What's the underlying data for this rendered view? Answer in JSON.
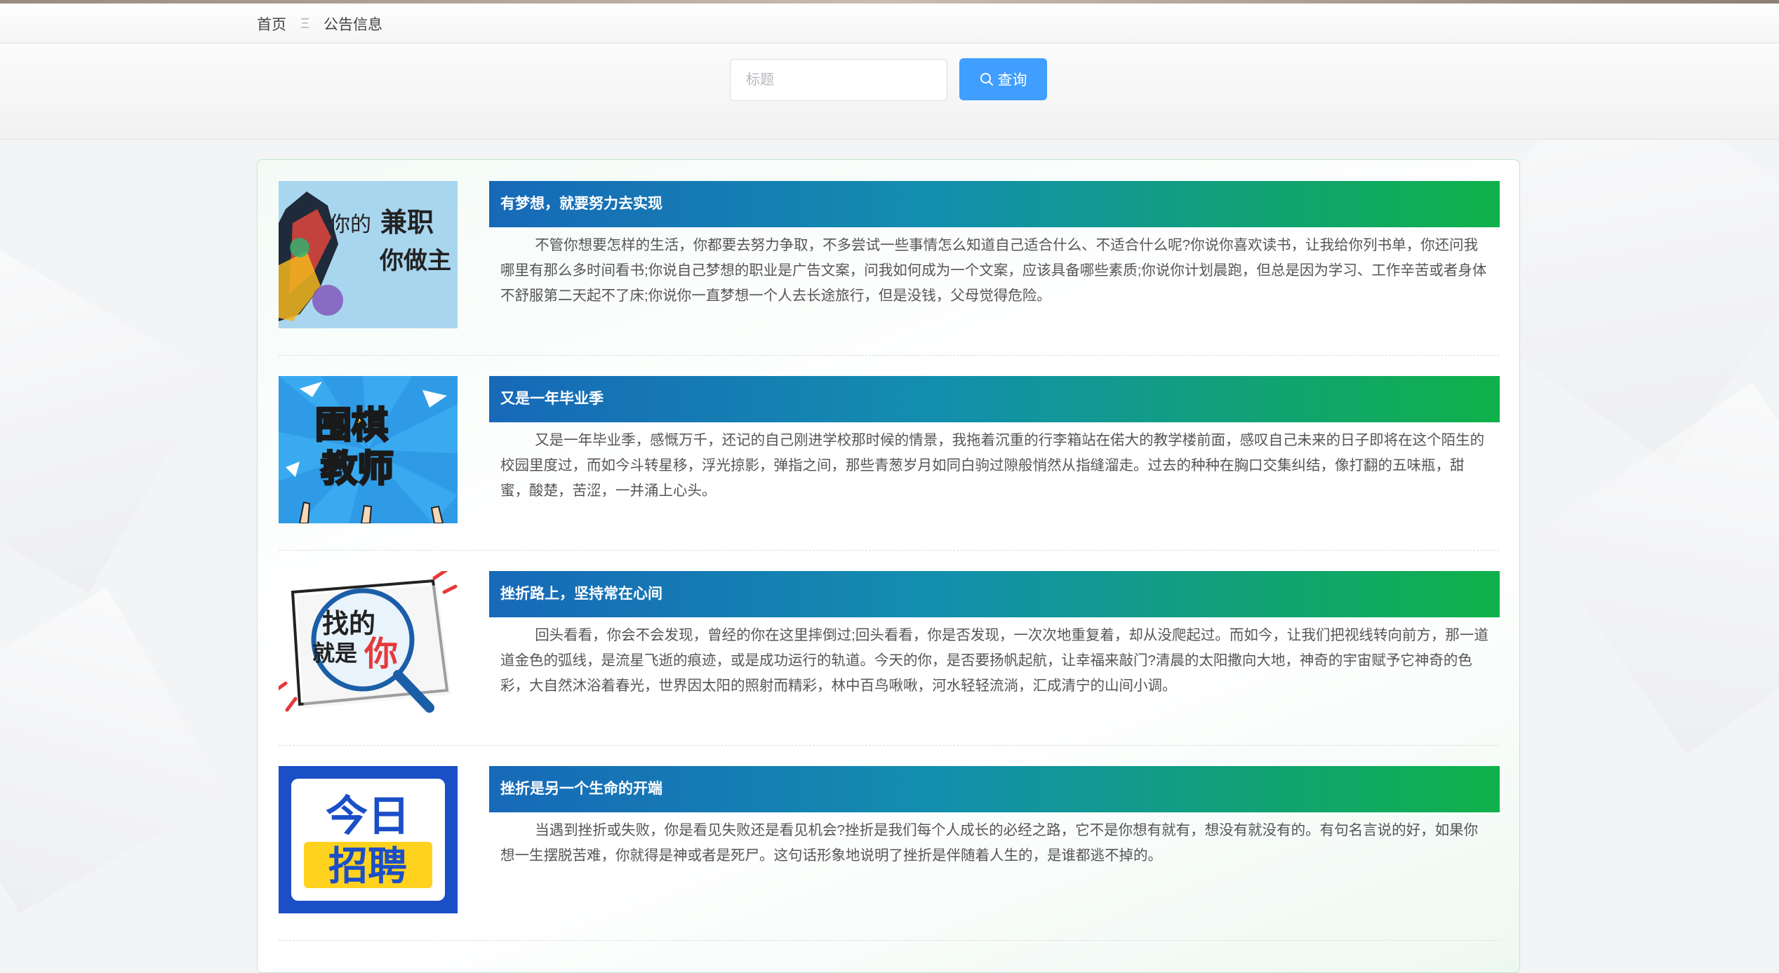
{
  "breadcrumb": {
    "home": "首页",
    "separator": "Ξ",
    "current": "公告信息"
  },
  "search": {
    "placeholder": "标题",
    "value": "",
    "button_label": "查询",
    "button_icon": "search-icon"
  },
  "colors": {
    "button": "#409eff",
    "title_gradient_start": "#1769b8",
    "title_gradient_end": "#0fb14a",
    "panel_border": "#bfe8cc"
  },
  "announcements": [
    {
      "title": "有梦想，就要努力去实现",
      "content": "不管你想要怎样的生活，你都要去努力争取，不多尝试一些事情怎么知道自己适合什么、不适合什么呢?你说你喜欢读书，让我给你列书单，你还问我哪里有那么多时间看书;你说自己梦想的职业是广告文案，问我如何成为一个文案，应该具备哪些素质;你说你计划晨跑，但总是因为学习、工作辛苦或者身体不舒服第二天起不了床;你说你一直梦想一个人去长途旅行，但是没钱，父母觉得危险。",
      "image_text": [
        "你的",
        "兼职",
        "你做主"
      ]
    },
    {
      "title": "又是一年毕业季",
      "content": "又是一年毕业季，感慨万千，还记的自己刚进学校那时候的情景，我拖着沉重的行李箱站在偌大的教学楼前面，感叹自己未来的日子即将在这个陌生的校园里度过，而如今斗转星移，浮光掠影，弹指之间，那些青葱岁月如同白驹过隙般悄然从指缝溜走。过去的种种在胸口交集纠结，像打翻的五味瓶，甜蜜，酸楚，苦涩，一并涌上心头。",
      "image_text": [
        "围棋",
        "教师"
      ]
    },
    {
      "title": "挫折路上，坚持常在心间",
      "content": "回头看看，你会不会发现，曾经的你在这里摔倒过;回头看看，你是否发现，一次次地重复着，却从没爬起过。而如今，让我们把视线转向前方，那一道道金色的弧线，是流星飞逝的痕迹，或是成功运行的轨道。今天的你，是否要扬帆起航，让幸福来敲门?清晨的太阳撒向大地，神奇的宇宙赋予它神奇的色彩，大自然沐浴着春光，世界因太阳的照射而精彩，林中百鸟啾啾，河水轻轻流淌，汇成清宁的山间小调。",
      "image_text": [
        "找的",
        "就是",
        "你"
      ]
    },
    {
      "title": "挫折是另一个生命的开端",
      "content": "当遇到挫折或失败，你是看见失败还是看见机会?挫折是我们每个人成长的必经之路，它不是你想有就有，想没有就没有的。有句名言说的好，如果你想一生摆脱苦难，你就得是神或者是死尸。这句话形象地说明了挫折是伴随着人生的，是谁都逃不掉的。",
      "image_text": [
        "今日",
        "招聘"
      ]
    }
  ]
}
